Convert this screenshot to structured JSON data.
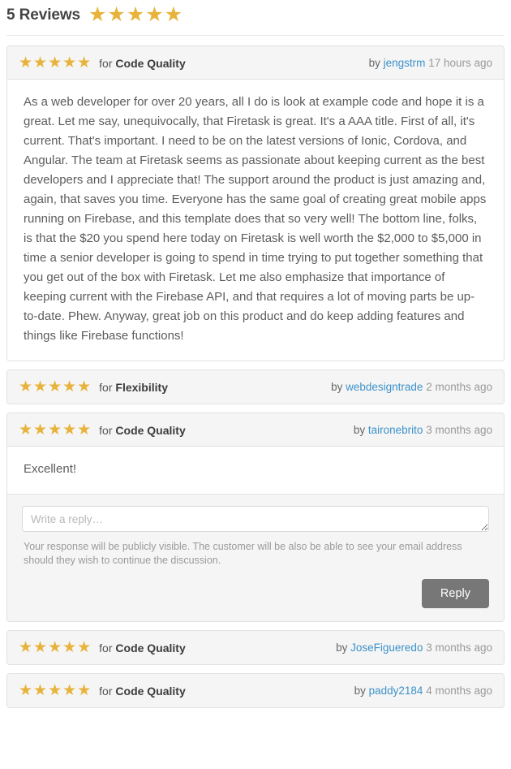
{
  "heading": {
    "count_label": "5 Reviews",
    "stars": "★★★★★",
    "star_count": 5
  },
  "colors": {
    "star": "#e8b33a",
    "author_link": "#3c92c9",
    "panel_header_bg": "#f5f5f5",
    "button_bg": "#777777",
    "border": "#e0e0e0"
  },
  "reviews": [
    {
      "stars": "★★★★★",
      "star_count": 5,
      "for_label": "for",
      "category": "Code Quality",
      "by_label": "by",
      "author": "jengstrm",
      "when": "17 hours ago",
      "body": "As a web developer for over 20 years, all I do is look at example code and hope it is a great. Let me say, unequivocally, that Firetask is great. It's a AAA title. First of all, it's current. That's important. I need to be on the latest versions of Ionic, Cordova, and Angular. The team at Firetask seems as passionate about keeping current as the best developers and I appreciate that! The support around the product is just amazing and, again, that saves you time. Everyone has the same goal of creating great mobile apps running on Firebase, and this template does that so very well! The bottom line, folks, is that the $20 you spend here today on Firetask is well worth the $2,000 to $5,000 in time a senior developer is going to spend in time trying to put together something that you get out of the box with Firetask. Let me also emphasize that importance of keeping current with the Firebase API, and that requires a lot of moving parts be up-to-date. Phew. Anyway, great job on this product and do keep adding features and things like Firebase functions!",
      "has_body": true,
      "has_reply_form": false
    },
    {
      "stars": "★★★★★",
      "star_count": 5,
      "for_label": "for",
      "category": "Flexibility",
      "by_label": "by",
      "author": "webdesigntrade",
      "when": "2 months ago",
      "body": "",
      "has_body": false,
      "has_reply_form": false
    },
    {
      "stars": "★★★★★",
      "star_count": 5,
      "for_label": "for",
      "category": "Code Quality",
      "by_label": "by",
      "author": "taironebrito",
      "when": "3 months ago",
      "body": "Excellent!",
      "has_body": true,
      "has_reply_form": true,
      "reply": {
        "value": "",
        "placeholder": "Write a reply…",
        "note": "Your response will be publicly visible. The customer will be also be able to see your email address should they wish to continue the discussion.",
        "button_label": "Reply"
      }
    },
    {
      "stars": "★★★★★",
      "star_count": 5,
      "for_label": "for",
      "category": "Code Quality",
      "by_label": "by",
      "author": "JoseFigueredo",
      "when": "3 months ago",
      "body": "",
      "has_body": false,
      "has_reply_form": false
    },
    {
      "stars": "★★★★★",
      "star_count": 5,
      "for_label": "for",
      "category": "Code Quality",
      "by_label": "by",
      "author": "paddy2184",
      "when": "4 months ago",
      "body": "",
      "has_body": false,
      "has_reply_form": false
    }
  ]
}
